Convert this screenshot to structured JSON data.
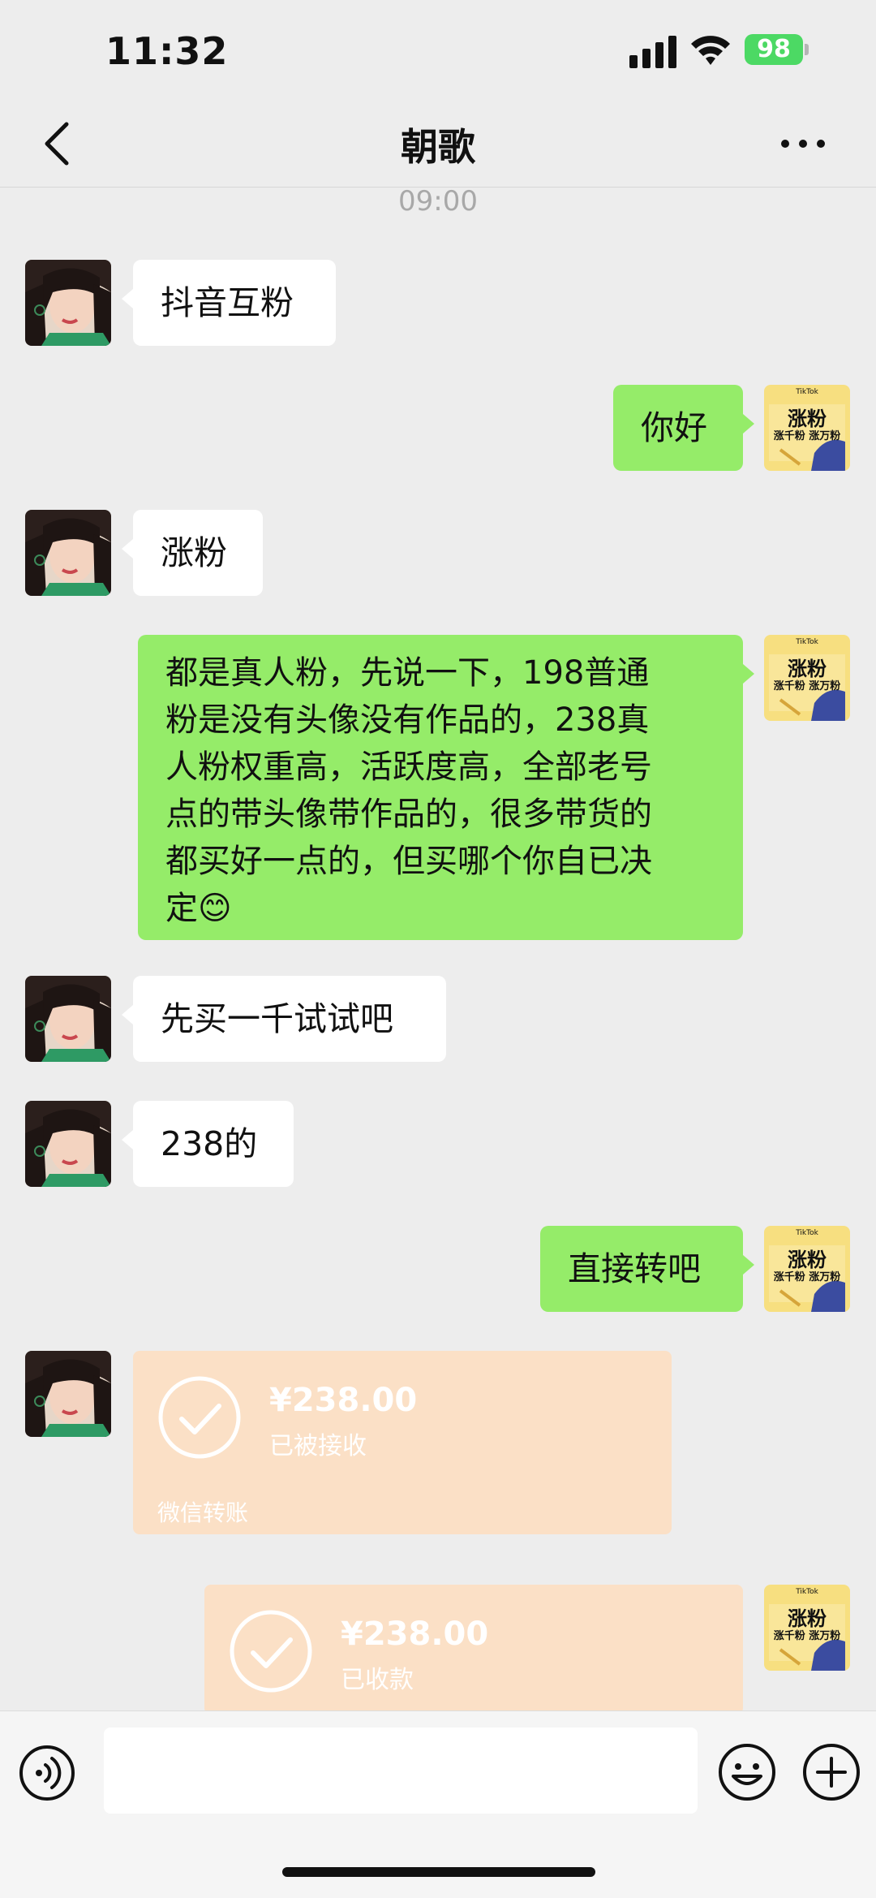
{
  "status_bar": {
    "time": "11:32",
    "battery": "98"
  },
  "header": {
    "title": "朝歌"
  },
  "timestamp": "09:00",
  "messages": [
    {
      "from": "contact",
      "text": "抖音互粉"
    },
    {
      "from": "me",
      "text": "你好"
    },
    {
      "from": "contact",
      "text": "涨粉"
    },
    {
      "from": "me",
      "lines": [
        "都是真人粉，先说一下，198普通",
        "粉是没有头像没有作品的，238真",
        "人粉权重高，活跃度高，全部老号",
        "点的带头像带作品的，很多带货的",
        "都买好一点的，但买哪个你自已决",
        "定"
      ],
      "emoji": "😊"
    },
    {
      "from": "contact",
      "text": "先买一千试试吧"
    },
    {
      "from": "contact",
      "text": "238的"
    },
    {
      "from": "me",
      "text": "直接转吧"
    }
  ],
  "transfers": [
    {
      "from": "contact",
      "amount": "¥238.00",
      "status": "已被接收",
      "footer": "微信转账"
    },
    {
      "from": "me",
      "amount": "¥238.00",
      "status": "已收款"
    }
  ],
  "my_avatar": {
    "line1": "涨粉",
    "line2": "涨千粉 涨万粉",
    "brand": "TikTok"
  },
  "colors": {
    "outgoing_bubble": "#95ec69",
    "incoming_bubble": "#ffffff",
    "transfer_card": "#fbe0c6",
    "background": "#ededed"
  },
  "icons": [
    "back-icon",
    "more-icon",
    "voice-icon",
    "emoji-icon",
    "plus-icon"
  ]
}
